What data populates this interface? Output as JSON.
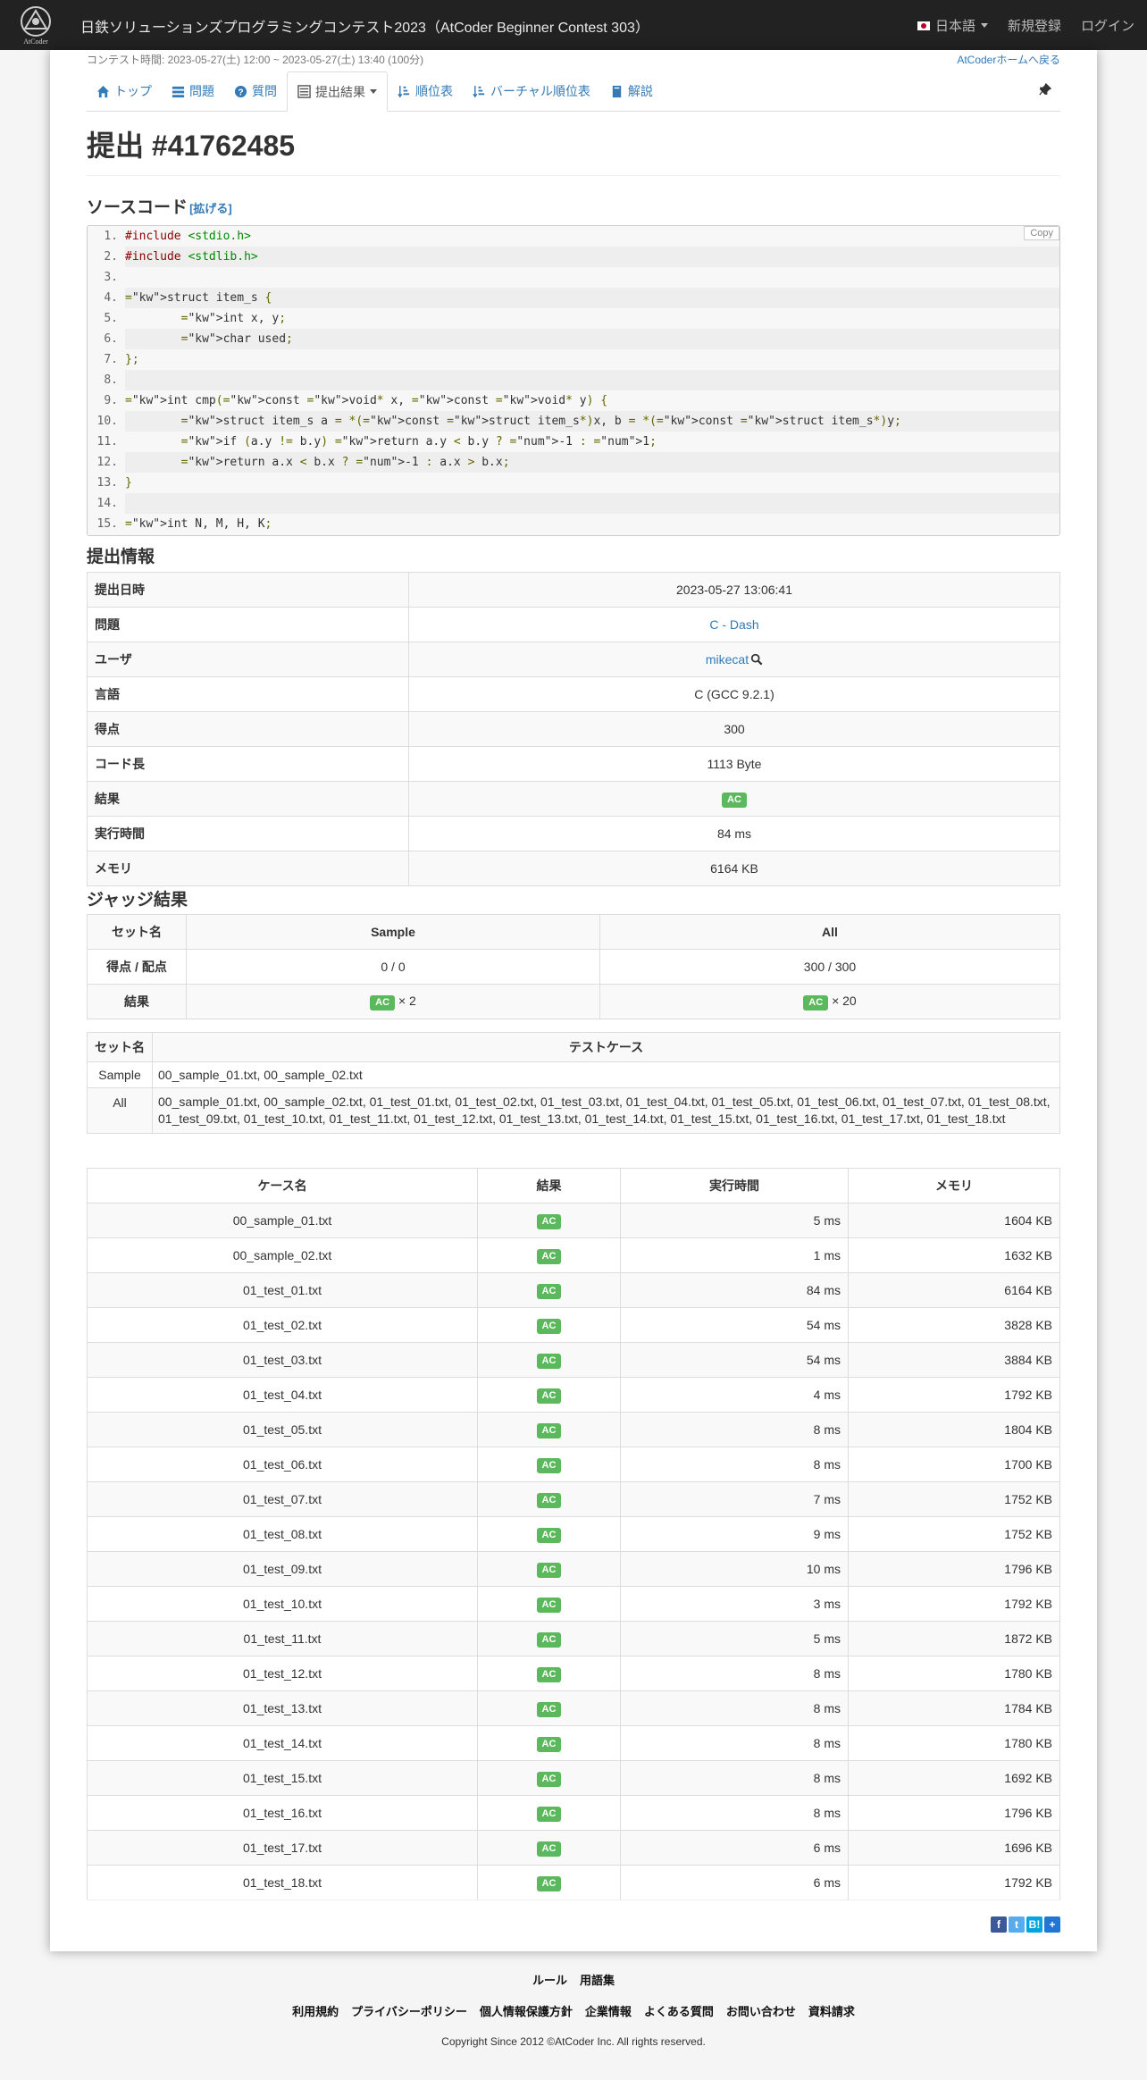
{
  "header": {
    "brand": "日鉄ソリューションズプログラミングコンテスト2023（AtCoder Beginner Contest 303）",
    "logo_text": "AtCoder",
    "language": "日本語",
    "register": "新規登録",
    "login": "ログイン"
  },
  "contest": {
    "time": "コンテスト時間: 2023-05-27(土) 12:00 ~ 2023-05-27(土) 13:40 (100分)",
    "home_link": "AtCoderホームへ戻る"
  },
  "tabs": [
    {
      "label": "トップ",
      "icon": "home-icon"
    },
    {
      "label": "問題",
      "icon": "list-icon"
    },
    {
      "label": "質問",
      "icon": "question-icon"
    },
    {
      "label": "提出結果",
      "icon": "list-alt-icon"
    },
    {
      "label": "順位表",
      "icon": "sort-icon"
    },
    {
      "label": "バーチャル順位表",
      "icon": "sort-icon"
    },
    {
      "label": "解説",
      "icon": "book-icon"
    }
  ],
  "page_title": "提出 #41762485",
  "source": {
    "heading": "ソースコード",
    "expand": "[拡げる]",
    "copy": "Copy",
    "lines": [
      "#include <stdio.h>",
      "#include <stdlib.h>",
      "",
      "struct item_s {",
      "        int x, y;",
      "        char used;",
      "};",
      "",
      "int cmp(const void* x, const void* y) {",
      "        struct item_s a = *(const struct item_s*)x, b = *(const struct item_s*)y;",
      "        if (a.y != b.y) return a.y < b.y ? -1 : 1;",
      "        return a.x < b.x ? -1 : a.x > b.x;",
      "}",
      "",
      "int N, M, H, K;"
    ]
  },
  "info": {
    "heading": "提出情報",
    "rows": [
      {
        "key": "提出日時",
        "value": "2023-05-27 13:06:41"
      },
      {
        "key": "問題",
        "value": "C - Dash"
      },
      {
        "key": "ユーザ",
        "value": "mikecat"
      },
      {
        "key": "言語",
        "value": "C (GCC 9.2.1)"
      },
      {
        "key": "得点",
        "value": "300"
      },
      {
        "key": "コード長",
        "value": "1113 Byte"
      },
      {
        "key": "結果",
        "value": "AC"
      },
      {
        "key": "実行時間",
        "value": "84 ms"
      },
      {
        "key": "メモリ",
        "value": "6164 KB"
      }
    ]
  },
  "judge": {
    "heading": "ジャッジ結果",
    "col_set": "セット名",
    "col_sample": "Sample",
    "col_all": "All",
    "score_label": "得点 / 配点",
    "score_sample": "0 / 0",
    "score_all": "300 / 300",
    "result_label": "結果",
    "badge": "AC",
    "count_sample": "× 2",
    "count_all": "× 20"
  },
  "sets": {
    "col_name": "セット名",
    "col_cases": "テストケース",
    "rows": [
      {
        "name": "Sample",
        "cases": "00_sample_01.txt, 00_sample_02.txt"
      },
      {
        "name": "All",
        "cases": "00_sample_01.txt, 00_sample_02.txt, 01_test_01.txt, 01_test_02.txt, 01_test_03.txt, 01_test_04.txt, 01_test_05.txt, 01_test_06.txt, 01_test_07.txt, 01_test_08.txt, 01_test_09.txt, 01_test_10.txt, 01_test_11.txt, 01_test_12.txt, 01_test_13.txt, 01_test_14.txt, 01_test_15.txt, 01_test_16.txt, 01_test_17.txt, 01_test_18.txt"
      }
    ]
  },
  "cases": {
    "headers": [
      "ケース名",
      "結果",
      "実行時間",
      "メモリ"
    ],
    "rows": [
      {
        "name": "00_sample_01.txt",
        "result": "AC",
        "time": "5 ms",
        "mem": "1604 KB"
      },
      {
        "name": "00_sample_02.txt",
        "result": "AC",
        "time": "1 ms",
        "mem": "1632 KB"
      },
      {
        "name": "01_test_01.txt",
        "result": "AC",
        "time": "84 ms",
        "mem": "6164 KB"
      },
      {
        "name": "01_test_02.txt",
        "result": "AC",
        "time": "54 ms",
        "mem": "3828 KB"
      },
      {
        "name": "01_test_03.txt",
        "result": "AC",
        "time": "54 ms",
        "mem": "3884 KB"
      },
      {
        "name": "01_test_04.txt",
        "result": "AC",
        "time": "4 ms",
        "mem": "1792 KB"
      },
      {
        "name": "01_test_05.txt",
        "result": "AC",
        "time": "8 ms",
        "mem": "1804 KB"
      },
      {
        "name": "01_test_06.txt",
        "result": "AC",
        "time": "8 ms",
        "mem": "1700 KB"
      },
      {
        "name": "01_test_07.txt",
        "result": "AC",
        "time": "7 ms",
        "mem": "1752 KB"
      },
      {
        "name": "01_test_08.txt",
        "result": "AC",
        "time": "9 ms",
        "mem": "1752 KB"
      },
      {
        "name": "01_test_09.txt",
        "result": "AC",
        "time": "10 ms",
        "mem": "1796 KB"
      },
      {
        "name": "01_test_10.txt",
        "result": "AC",
        "time": "3 ms",
        "mem": "1792 KB"
      },
      {
        "name": "01_test_11.txt",
        "result": "AC",
        "time": "5 ms",
        "mem": "1872 KB"
      },
      {
        "name": "01_test_12.txt",
        "result": "AC",
        "time": "8 ms",
        "mem": "1780 KB"
      },
      {
        "name": "01_test_13.txt",
        "result": "AC",
        "time": "8 ms",
        "mem": "1784 KB"
      },
      {
        "name": "01_test_14.txt",
        "result": "AC",
        "time": "8 ms",
        "mem": "1780 KB"
      },
      {
        "name": "01_test_15.txt",
        "result": "AC",
        "time": "8 ms",
        "mem": "1692 KB"
      },
      {
        "name": "01_test_16.txt",
        "result": "AC",
        "time": "8 ms",
        "mem": "1796 KB"
      },
      {
        "name": "01_test_17.txt",
        "result": "AC",
        "time": "6 ms",
        "mem": "1696 KB"
      },
      {
        "name": "01_test_18.txt",
        "result": "AC",
        "time": "6 ms",
        "mem": "1792 KB"
      }
    ]
  },
  "share": [
    {
      "label": "f",
      "color": "#3b5998",
      "icon": "facebook-icon"
    },
    {
      "label": "t",
      "color": "#55acee",
      "icon": "twitter-icon"
    },
    {
      "label": "B!",
      "color": "#00a4de",
      "icon": "hatena-icon"
    },
    {
      "label": "+",
      "color": "#1e77d6",
      "icon": "share-plus-icon"
    }
  ],
  "footer": {
    "links1": [
      "ルール",
      "用語集"
    ],
    "links2": [
      "利用規約",
      "プライバシーポリシー",
      "個人情報保護方針",
      "企業情報",
      "よくある質問",
      "お問い合わせ",
      "資料請求"
    ],
    "copyright": "Copyright Since 2012 ©AtCoder Inc. All rights reserved."
  },
  "colors": {
    "accent": "#337ab7",
    "ac_badge": "#5cb85c",
    "navbar": "#222222"
  }
}
